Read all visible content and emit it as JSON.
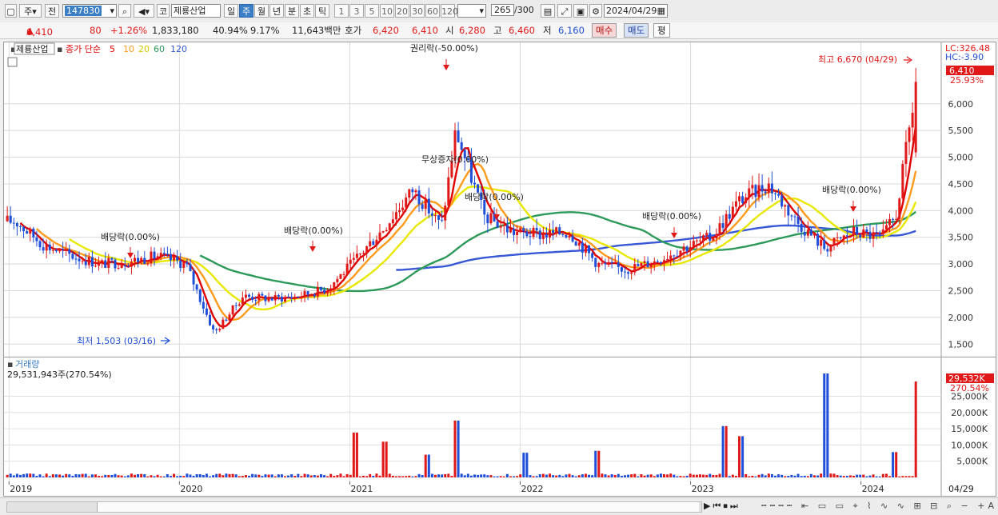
{
  "toolbar": {
    "type_label": "주",
    "prev_label": "전",
    "code": "147830",
    "market_label": "코",
    "stock_name": "제룡산업",
    "period_tabs": [
      "일",
      "주",
      "월",
      "년",
      "분",
      "초",
      "틱"
    ],
    "active_period": "주",
    "interval_buttons": [
      "1",
      "3",
      "5",
      "10",
      "20",
      "30",
      "60",
      "120"
    ],
    "count": "265",
    "count_total": "/300",
    "date": "2024/04/29"
  },
  "quote": {
    "price": "6,410",
    "change": "80",
    "change_pct": "+1.26%",
    "volume": "1,833,180",
    "volume_ratio": "40.94%",
    "turnover": "9.17%",
    "amount": "11,643백만",
    "hoga_label": "호가",
    "ask": "6,420",
    "bid": "6,410",
    "open_label": "시",
    "open": "6,280",
    "high_label": "고",
    "high": "6,460",
    "low_label": "저",
    "low": "6,160",
    "buy_button": "매수",
    "sell_button": "매도",
    "avg_button": "평"
  },
  "price_panel": {
    "title": "제룡산업",
    "ma_label": "종가 단순",
    "ma_periods": [
      "5",
      "10",
      "20",
      "60",
      "120"
    ],
    "lc_label": "LC:326.48",
    "hc_label": "HC:-3.90",
    "last_price_badge": "6,410",
    "last_change_badge": "25.93%",
    "annotations": {
      "rights": "권리락(-50.00%)",
      "bonus": "무상증자(0.00%)",
      "div2019": "배당락(0.00%)",
      "div2020": "배당락(0.00%)",
      "div2021": "배당락(0.00%)",
      "div2022": "배당락(0.00%)",
      "div2023": "배당락(0.00%)",
      "high": "최고 6,670 (04/29)",
      "low": "최저 1,503 (03/16)"
    }
  },
  "volume_panel": {
    "title": "거래량",
    "summary": "29,531,943주(270.54%)",
    "last_badge": "29,532K",
    "last_pct_badge": "270.54%"
  },
  "x_axis": [
    "2019",
    "2020",
    "2021",
    "2022",
    "2023",
    "2024"
  ],
  "x_last_label": "04/29",
  "colors": {
    "up": "#e01818",
    "down": "#1f4fd8",
    "ma5": "#e00000",
    "ma10": "#ff9a1a",
    "ma20": "#e8e800",
    "ma60": "#2e9a5a",
    "ma120": "#3858d6",
    "accent": "#3a7ec4"
  },
  "chart_data": {
    "type": "candlestick",
    "frequency": "weekly",
    "y_ticks": [
      1500,
      2000,
      2500,
      3000,
      3500,
      4000,
      4500,
      5000,
      5500,
      6000
    ],
    "y_range": [
      1250,
      6850
    ],
    "volume_ticks_k": [
      5000,
      10000,
      15000,
      20000,
      25000
    ],
    "volume_range_k": [
      0,
      32000
    ],
    "series_close_approx": [
      [
        "2019-01",
        3800
      ],
      [
        "2019-03",
        3350
      ],
      [
        "2019-05",
        3150
      ],
      [
        "2019-07",
        3000
      ],
      [
        "2019-09",
        3050
      ],
      [
        "2019-11",
        3150
      ],
      [
        "2020-01",
        3000
      ],
      [
        "2020-03",
        1700
      ],
      [
        "2020-05",
        2400
      ],
      [
        "2020-07",
        2350
      ],
      [
        "2020-09",
        2400
      ],
      [
        "2020-11",
        2550
      ],
      [
        "2021-01",
        3100
      ],
      [
        "2021-03",
        3700
      ],
      [
        "2021-05",
        4400
      ],
      [
        "2021-07",
        3700
      ],
      [
        "2021-08",
        5500
      ],
      [
        "2021-10",
        3900
      ],
      [
        "2021-12",
        3600
      ],
      [
        "2022-02",
        3550
      ],
      [
        "2022-04",
        3600
      ],
      [
        "2022-06",
        3000
      ],
      [
        "2022-08",
        2900
      ],
      [
        "2022-10",
        3050
      ],
      [
        "2022-12",
        3300
      ],
      [
        "2023-02",
        3500
      ],
      [
        "2023-04",
        4200
      ],
      [
        "2023-06",
        4500
      ],
      [
        "2023-08",
        3800
      ],
      [
        "2023-10",
        3300
      ],
      [
        "2023-12",
        3600
      ],
      [
        "2024-02",
        3500
      ],
      [
        "2024-03",
        3900
      ],
      [
        "2024-04-29",
        6410
      ]
    ],
    "volume_spikes_k": [
      [
        "2021-01",
        13800
      ],
      [
        "2021-03",
        11000
      ],
      [
        "2021-06",
        7000
      ],
      [
        "2021-08",
        17500
      ],
      [
        "2022-01",
        7600
      ],
      [
        "2022-06",
        8200
      ],
      [
        "2023-03",
        15800
      ],
      [
        "2023-04",
        12700
      ],
      [
        "2023-10",
        32000
      ],
      [
        "2024-03",
        7800
      ],
      [
        "2024-04-29",
        29532
      ]
    ]
  }
}
